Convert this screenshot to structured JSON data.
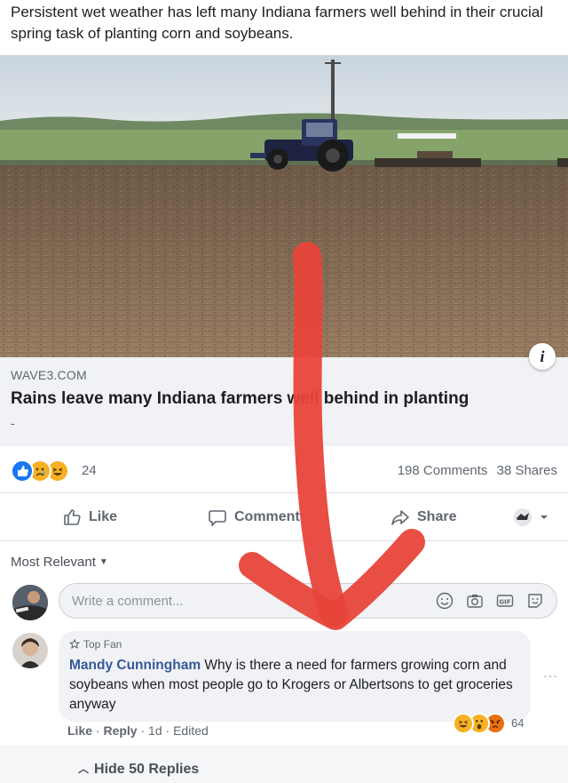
{
  "post": {
    "text": "Persistent wet weather has left many Indiana farmers well behind in their crucial spring task of planting corn and soybeans."
  },
  "link": {
    "domain": "WAVE3.COM",
    "title": "Rains leave many Indiana farmers well behind in planting",
    "description": "-"
  },
  "reactions": {
    "count": "24",
    "comments": "198 Comments",
    "shares": "38 Shares"
  },
  "actions": {
    "like": "Like",
    "comment": "Comment",
    "share": "Share"
  },
  "sort": {
    "label": "Most Relevant"
  },
  "comment_input": {
    "placeholder": "Write a comment..."
  },
  "comment": {
    "badge": "Top Fan",
    "author": "Mandy Cunningham",
    "text": "Why is there a need for farmers growing corn and soybeans when most people go to Krogers or Albertsons to get groceries anyway",
    "like": "Like",
    "reply": "Reply",
    "time": "1d",
    "edited": "Edited",
    "reaction_count": "64"
  },
  "replies": {
    "hide_label": "Hide 50 Replies"
  },
  "colors": {
    "link_blue": "#385898",
    "like_blue": "#1877f2",
    "arrow_red": "#e8443a"
  },
  "icons": [
    "info-icon",
    "like-thumb-icon",
    "comment-icon",
    "share-icon",
    "emoji-icon",
    "camera-icon",
    "gif-icon",
    "sticker-icon",
    "top-fan-icon"
  ]
}
